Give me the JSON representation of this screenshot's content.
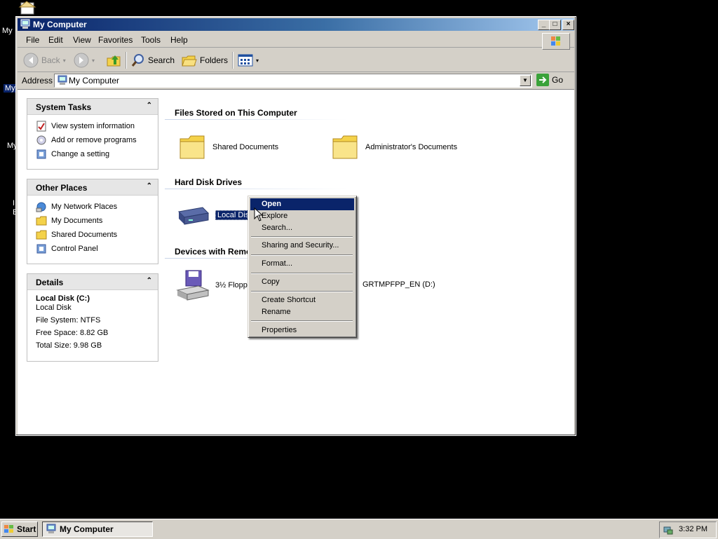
{
  "desktop": {
    "fragments": [
      "My",
      "My",
      "My",
      "I",
      "E"
    ]
  },
  "window": {
    "title": "My Computer",
    "controls": {
      "minimize": "_",
      "maximize": "□",
      "close": "×"
    }
  },
  "menu": [
    "File",
    "Edit",
    "View",
    "Favorites",
    "Tools",
    "Help"
  ],
  "toolbar": {
    "back": "Back",
    "search": "Search",
    "folders": "Folders"
  },
  "address": {
    "label": "Address",
    "value": "My Computer",
    "go": "Go"
  },
  "task_pane": {
    "system_tasks": {
      "title": "System Tasks",
      "items": [
        "View system information",
        "Add or remove programs",
        "Change a setting"
      ]
    },
    "other_places": {
      "title": "Other Places",
      "items": [
        "My Network Places",
        "My Documents",
        "Shared Documents",
        "Control Panel"
      ]
    },
    "details": {
      "title": "Details",
      "name": "Local Disk (C:)",
      "type": "Local Disk",
      "file_system": "File System: NTFS",
      "free_space": "Free Space: 8.82 GB",
      "total_size": "Total Size: 9.98 GB"
    }
  },
  "main": {
    "files_stored": {
      "title": "Files Stored on This Computer",
      "items": [
        "Shared Documents",
        "Administrator's Documents"
      ]
    },
    "hard_disks": {
      "title": "Hard Disk Drives",
      "items": [
        "Local Disk"
      ]
    },
    "removable": {
      "title": "Devices with Remo",
      "items": [
        "3½ Floppy",
        "GRTMPFPP_EN (D:)"
      ]
    }
  },
  "context_menu": {
    "items": [
      "Open",
      "Explore",
      "Search...",
      "Sharing and Security...",
      "Format...",
      "Copy",
      "Create Shortcut",
      "Rename",
      "Properties"
    ]
  },
  "taskbar": {
    "start": "Start",
    "task": "My Computer",
    "clock": "3:32 PM"
  }
}
